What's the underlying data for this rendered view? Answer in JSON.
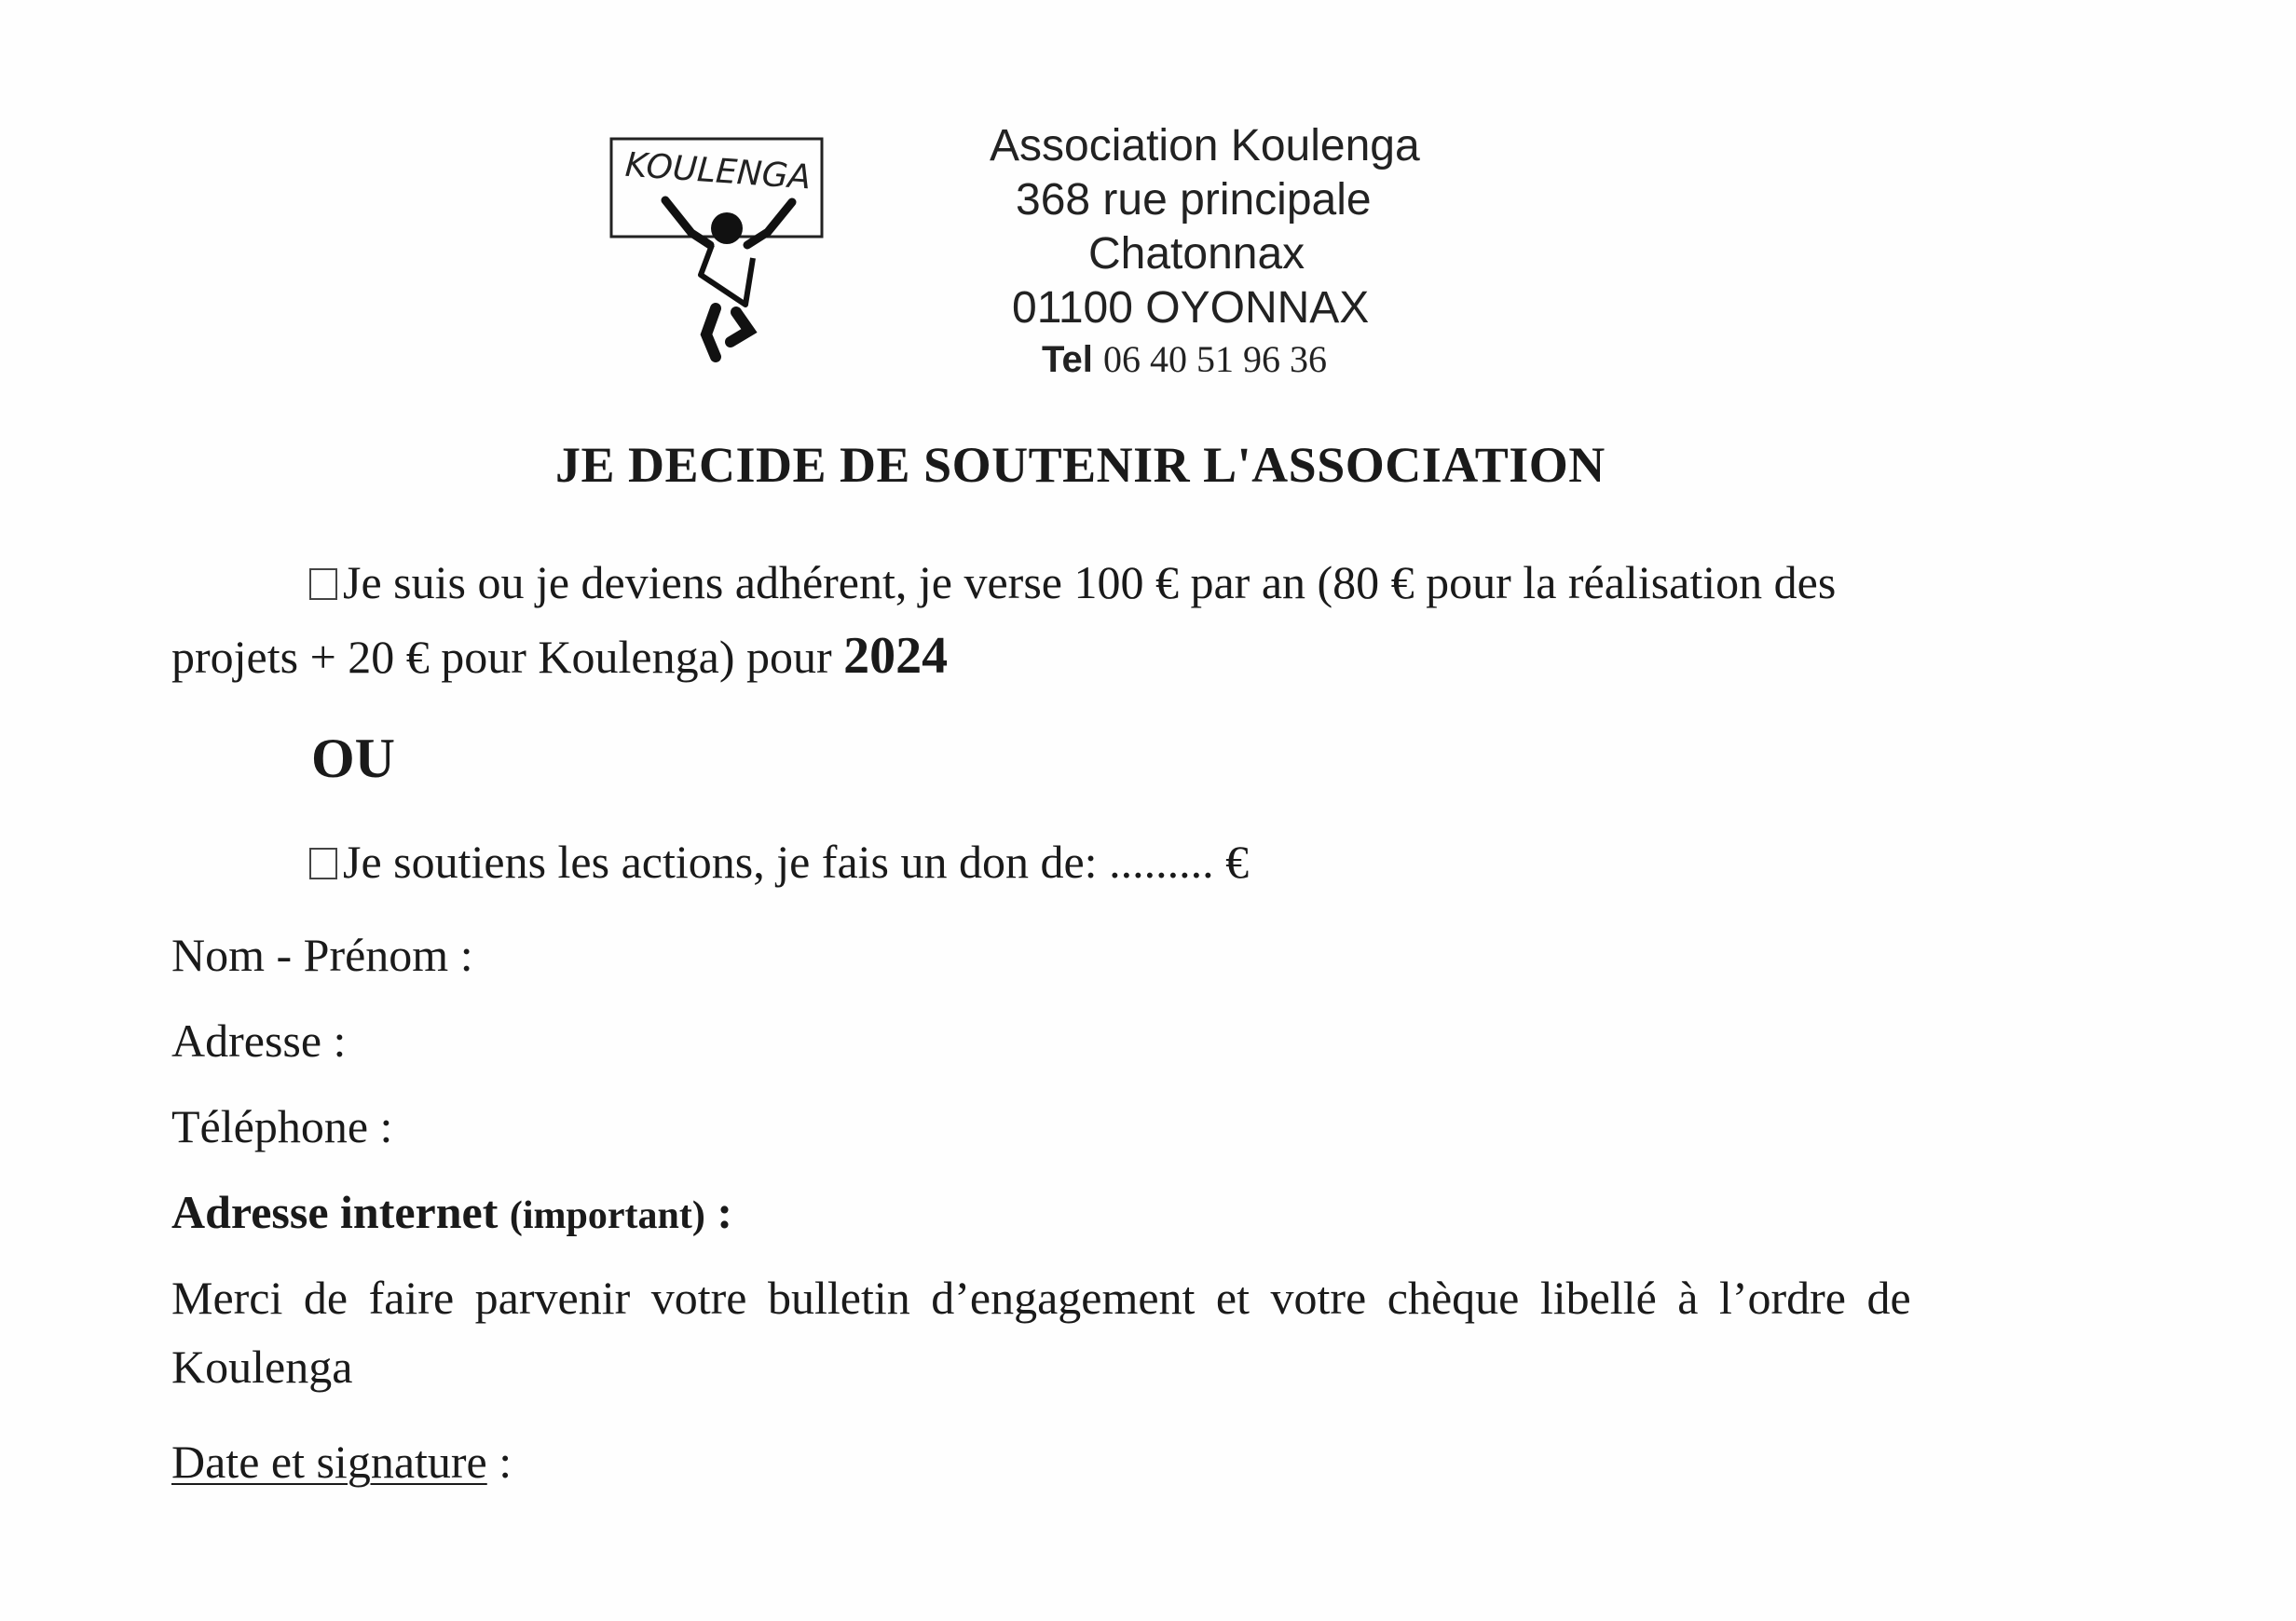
{
  "header": {
    "logo_text": "KOULENGA",
    "name": "Association Koulenga",
    "street": "368 rue principale",
    "city": "Chatonnax",
    "postal": "01100 OYONNAX",
    "tel_label": "Tel",
    "tel_number": "06 40 51 96 36"
  },
  "title": "JE DECIDE DE SOUTENIR L'ASSOCIATION",
  "option1": {
    "line1": "Je suis ou je deviens adhérent, je verse 100 € par an (80 € pour la réalisation des",
    "line2": "projets + 20 € pour Koulenga)  pour",
    "year": "2024"
  },
  "separator": "OU",
  "option2": {
    "text": "Je soutiens les actions, je fais un don de: ......... €"
  },
  "fields": {
    "name": "Nom - Prénom :",
    "address": "Adresse :",
    "phone": "Téléphone :",
    "email_label": "Adresse internet",
    "email_note": "(important)",
    "email_colon": " :"
  },
  "notice": {
    "line1": "Merci de faire parvenir votre bulletin d’engagement et votre chèque libellé à l’ordre de",
    "line2": "Koulenga"
  },
  "signature": {
    "label": "Date et signature",
    "colon": " :"
  }
}
